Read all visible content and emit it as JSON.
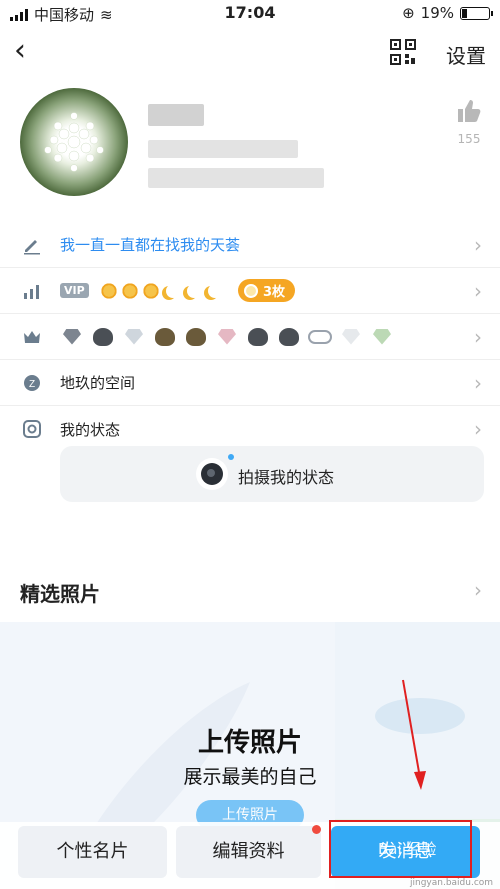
{
  "status": {
    "carrier": "中国移动",
    "time": "17:04",
    "battery": "19%",
    "battery_level": 0.19
  },
  "nav": {
    "settings_label": "设置"
  },
  "profile": {
    "like_count": "155"
  },
  "rows": {
    "signature": "我一直一直都在找我的天荟",
    "vip_tag": "VIP",
    "coins": "3枚",
    "space": "地玖的空间",
    "status": "我的状态"
  },
  "shoot": {
    "label": "拍摄我的状态"
  },
  "photos": {
    "title": "精选照片",
    "upload_title": "上传照片",
    "upload_subtitle": "展示最美的自己",
    "upload_button": "上传照片"
  },
  "bottom": {
    "card_label": "个性名片",
    "edit_label": "编辑资料",
    "send_label": "发消息"
  },
  "watermark": {
    "text": "Bai 经验",
    "url": "jingyan.baidu.com"
  },
  "colors": {
    "accent": "#33aaf5",
    "link": "#2d8cf0",
    "highlight": "#e02020"
  }
}
